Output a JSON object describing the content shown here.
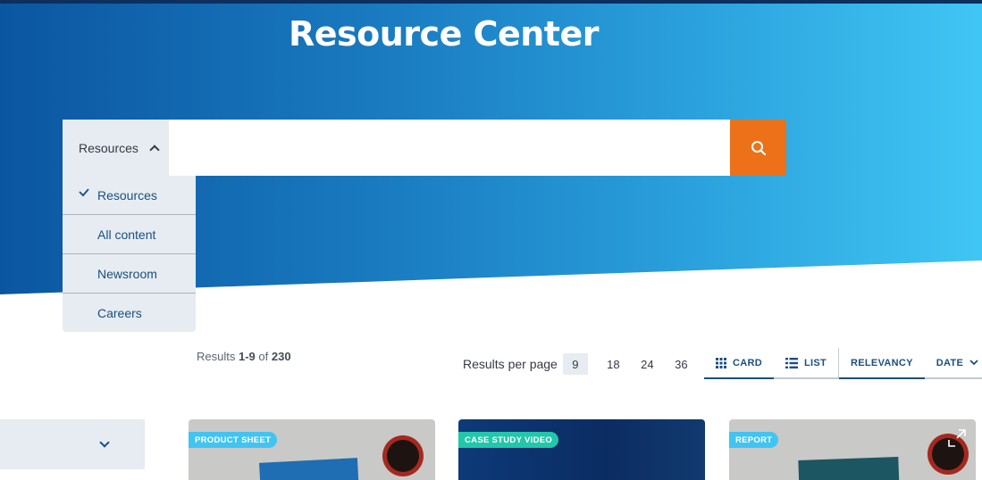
{
  "header": {
    "title": "Resource Center"
  },
  "search": {
    "scope_label": "Resources",
    "placeholder": "",
    "scope_options": [
      {
        "label": "Resources",
        "selected": true
      },
      {
        "label": "All content",
        "selected": false
      },
      {
        "label": "Newsroom",
        "selected": false
      },
      {
        "label": "Careers",
        "selected": false
      }
    ]
  },
  "results": {
    "prefix": "Results",
    "range": "1-9",
    "of_label": "of",
    "total": "230"
  },
  "results_per_page": {
    "label": "Results per page",
    "options": [
      "9",
      "18",
      "24",
      "36"
    ],
    "selected": "9"
  },
  "view": {
    "card_label": "CARD",
    "list_label": "LIST",
    "relevancy_label": "RELEVANCY",
    "date_label": "DATE"
  },
  "cards": [
    {
      "badge": "PRODUCT SHEET",
      "badge_color": "#41c4f2"
    },
    {
      "badge": "CASE STUDY VIDEO",
      "badge_color": "#22c7a9"
    },
    {
      "badge": "REPORT",
      "badge_color": "#41c4f2"
    }
  ],
  "colors": {
    "accent_orange": "#ec7118",
    "navy": "#1b4f80",
    "panel_gray": "#e6ecf1"
  }
}
